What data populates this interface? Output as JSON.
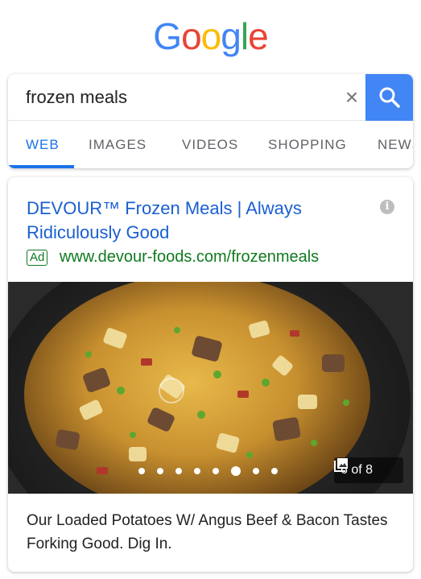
{
  "logo": {
    "letters": [
      "G",
      "o",
      "o",
      "g",
      "l",
      "e"
    ],
    "colors": [
      "#4285f4",
      "#ea4335",
      "#fbbc05",
      "#4285f4",
      "#34a853",
      "#ea4335"
    ]
  },
  "search": {
    "value": "frozen meals",
    "placeholder": "",
    "clear_icon": "×",
    "accent": "#4285f4"
  },
  "tabs": [
    {
      "label": "WEB",
      "active": true
    },
    {
      "label": "IMAGES",
      "active": false
    },
    {
      "label": "VIDEOS",
      "active": false
    },
    {
      "label": "SHOPPING",
      "active": false
    },
    {
      "label": "NEWS",
      "active": false
    }
  ],
  "ad": {
    "title": "DEVOUR™ Frozen Meals | Always Ridiculously Good",
    "badge": "Ad",
    "url": "www.devour-foods.com/frozenmeals",
    "info_icon": "info-icon",
    "carousel": {
      "current": 6,
      "total": 8,
      "counter": "6 of 8",
      "dot_count": 8
    },
    "description": "Our Loaded Potatoes W/ Angus Beef & Bacon Tastes Forking Good. Dig In."
  },
  "colors": {
    "link": "#1a5fd1",
    "url_green": "#0f7a1f",
    "tab_active": "#1a73e8"
  }
}
